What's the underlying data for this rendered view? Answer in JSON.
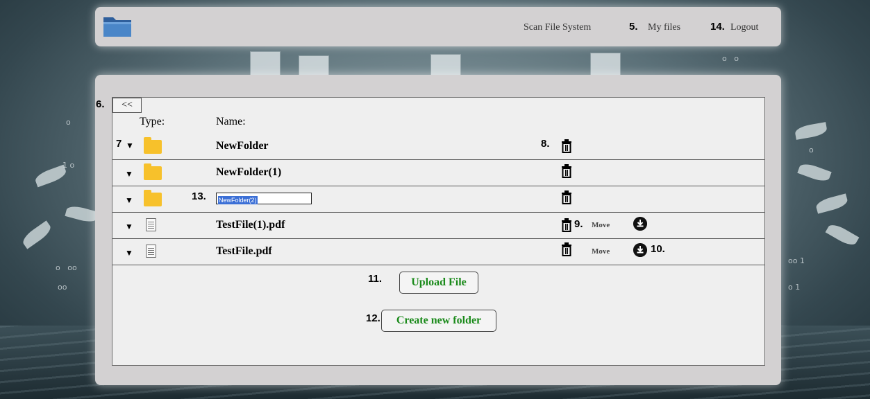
{
  "navbar": {
    "logo_icon": "folder-icon",
    "links": [
      {
        "label": "Scan File System"
      },
      {
        "num": "5.",
        "label": "My files"
      },
      {
        "num": "14.",
        "label": "Logout"
      }
    ]
  },
  "panel": {
    "back_num": "6.",
    "back_label": "<<",
    "headers": {
      "type": "Type:",
      "name": "Name:"
    },
    "rows": [
      {
        "num": "7",
        "kind": "folder",
        "name": "NewFolder",
        "trash_num": "8."
      },
      {
        "kind": "folder",
        "name": "NewFolder(1)"
      },
      {
        "kind": "folder",
        "name_num": "13.",
        "editing_value": "NewFolder(2)"
      },
      {
        "kind": "file",
        "name": "TestFile(1).pdf",
        "trash_num": "9.",
        "move_label": "Move"
      },
      {
        "kind": "file",
        "name": "TestFile.pdf",
        "move_label": "Move",
        "download_num": "10."
      }
    ],
    "upload": {
      "num": "11.",
      "label": "Upload File"
    },
    "create": {
      "num": "12.",
      "label": "Create new folder"
    }
  },
  "colors": {
    "folder": "#f7c12b",
    "button_text": "#1a8a1a",
    "panel": "#d3d1d2"
  }
}
